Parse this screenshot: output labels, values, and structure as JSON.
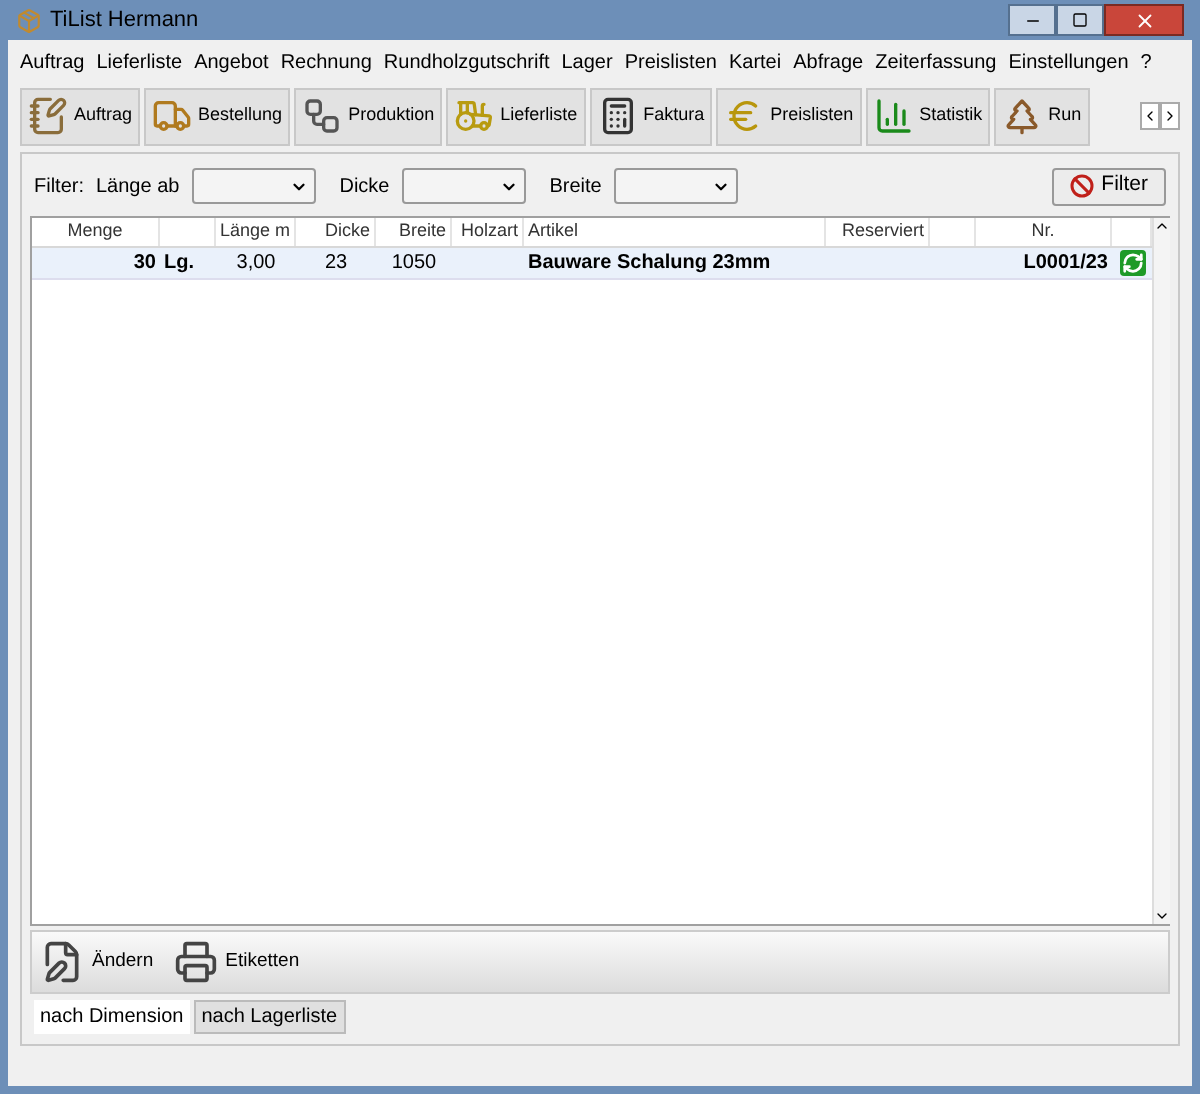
{
  "window": {
    "title": "TiList  Hermann"
  },
  "menu": [
    "Auftrag",
    "Lieferliste",
    "Angebot",
    "Rechnung",
    "Rundholzgutschrift",
    "Lager",
    "Preislisten",
    "Kartei",
    "Abfrage",
    "Zeiterfassung",
    "Einstellungen",
    "?"
  ],
  "toolbar": [
    {
      "label": "Auftrag",
      "kind": "notes"
    },
    {
      "label": "Bestellung",
      "kind": "truck"
    },
    {
      "label": "Produktion",
      "kind": "flow"
    },
    {
      "label": "Lieferliste",
      "kind": "loader"
    },
    {
      "label": "Faktura",
      "kind": "calculator"
    },
    {
      "label": "Preislisten",
      "kind": "coin"
    },
    {
      "label": "Statistik",
      "kind": "chart"
    },
    {
      "label": "Run",
      "kind": "logs"
    }
  ],
  "filter": {
    "label": "Filter:",
    "fields": [
      {
        "label": "Länge ab"
      },
      {
        "label": "Dicke"
      },
      {
        "label": "Breite"
      }
    ],
    "button": "Filter"
  },
  "table": {
    "columns": [
      "Menge",
      "",
      "Länge m",
      "Dicke",
      "Breite",
      "Holzart",
      "Artikel",
      "Reserviert",
      "",
      "Nr.",
      ""
    ],
    "rows": [
      {
        "selected": true,
        "cells": [
          "30",
          "Lg.",
          "3,00",
          "23",
          "1050",
          "",
          "Bauware Schalung 23mm",
          "",
          "",
          "L0001/23"
        ]
      }
    ]
  },
  "actions": [
    {
      "label": "Ändern",
      "kind": "edit"
    },
    {
      "label": "Etiketten",
      "kind": "printer"
    }
  ],
  "tabs": [
    {
      "label": "nach Dimension",
      "selected": true
    },
    {
      "label": "nach Lagerliste",
      "selected": false
    }
  ]
}
